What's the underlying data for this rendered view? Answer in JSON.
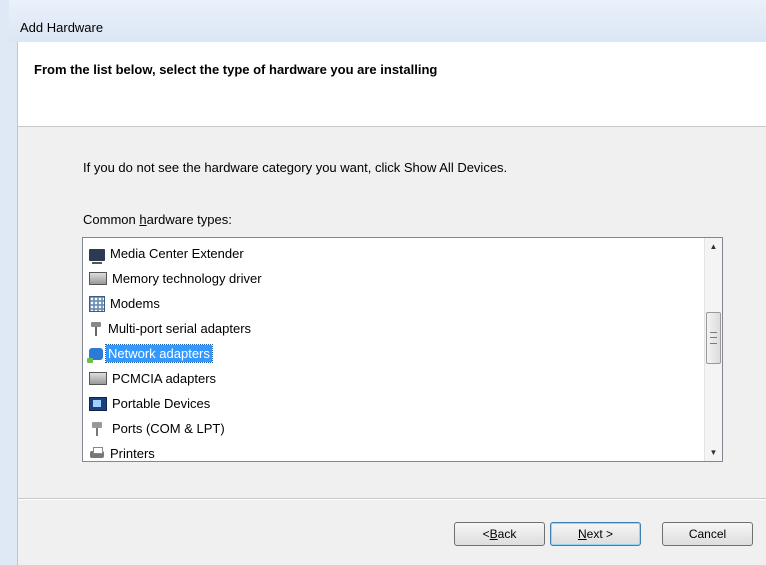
{
  "window": {
    "title": "Add Hardware"
  },
  "header": {
    "title": "From the list below, select the type of hardware you are installing"
  },
  "body": {
    "hint": "If you do not see the hardware category you want, click Show All Devices.",
    "list_label_prefix": "Common ",
    "list_label_mnemonic": "h",
    "list_label_suffix": "ardware types:"
  },
  "hardware_list": {
    "items": [
      {
        "label": "Media Center Extender",
        "icon": "monitor-icon"
      },
      {
        "label": "Memory technology driver",
        "icon": "memory-card-icon"
      },
      {
        "label": "Modems",
        "icon": "modem-icon"
      },
      {
        "label": "Multi-port serial adapters",
        "icon": "serial-port-icon"
      },
      {
        "label": "Network adapters",
        "icon": "network-adapter-icon",
        "selected": true
      },
      {
        "label": "PCMCIA adapters",
        "icon": "pcmcia-card-icon"
      },
      {
        "label": "Portable Devices",
        "icon": "portable-device-icon"
      },
      {
        "label": "Ports (COM & LPT)",
        "icon": "port-connector-icon"
      },
      {
        "label": "Printers",
        "icon": "printer-icon"
      }
    ],
    "scrollbar": {
      "up": "▲",
      "down": "▼"
    }
  },
  "buttons": {
    "back_prefix": "< ",
    "back_mnemonic": "B",
    "back_suffix": "ack",
    "next_mnemonic": "N",
    "next_suffix": "ext >",
    "cancel": "Cancel"
  },
  "colors": {
    "selection": "#3399ff",
    "header_bg": "#ffffff",
    "dialog_bg": "#f0f0f0"
  }
}
